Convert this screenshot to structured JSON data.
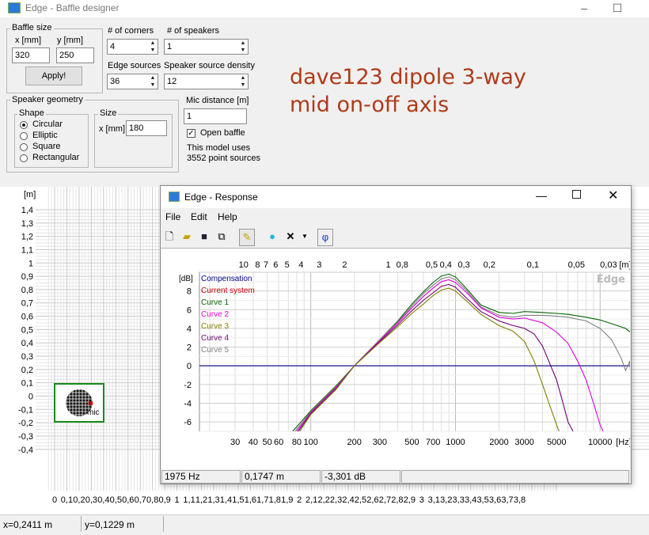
{
  "window": {
    "title": "Edge - Baffle designer",
    "minimize": "–",
    "maximize": "☐"
  },
  "baffle_size": {
    "label": "Baffle size",
    "x_label": "x [mm]",
    "y_label": "y [mm]",
    "x_value": "320",
    "y_value": "250",
    "apply_label": "Apply!"
  },
  "corners": {
    "label": "# of corners",
    "value": "4"
  },
  "speakers": {
    "label": "# of speakers",
    "value": "1"
  },
  "edge_sources": {
    "label": "Edge sources",
    "value": "36"
  },
  "speaker_density": {
    "label": "Speaker source density",
    "value": "12"
  },
  "annotation": {
    "line1": "dave123 dipole 3-way",
    "line2": "mid on-off axis"
  },
  "speaker_geometry": {
    "label": "Speaker geometry",
    "shape_label": "Shape",
    "shapes": [
      "Circular",
      "Elliptic",
      "Square",
      "Rectangular"
    ],
    "selected": "Circular",
    "size_label": "Size",
    "size_x_label": "x [mm]",
    "size_x_value": "180"
  },
  "mic": {
    "distance_label": "Mic distance [m]",
    "distance_value": "1",
    "open_baffle_label": "Open baffle",
    "model_info_1": "This model uses",
    "model_info_2": "3552 point sources",
    "mic_marker": "mic"
  },
  "baffle_plot": {
    "y_unit": "[m]",
    "y_ticks": [
      "1,4",
      "1,3",
      "1,2",
      "1,1",
      "1",
      "0,9",
      "0,8",
      "0,7",
      "0,6",
      "0,5",
      "0,4",
      "0,3",
      "0,2",
      "0,1",
      "0",
      "-0,1",
      "-0,2",
      "-0,3",
      "-0,4"
    ],
    "x_ticks": [
      "0",
      "0,1",
      "0,2",
      "0,3",
      "0,4",
      "0,5",
      "0,6",
      "0,7",
      "0,8",
      "0,9",
      "1",
      "1,1",
      "1,2",
      "1,3",
      "1,4",
      "1,5",
      "1,6",
      "1,7",
      "1,8",
      "1,9",
      "2",
      "2,1",
      "2,2",
      "2,3",
      "2,4",
      "2,5",
      "2,6",
      "2,7",
      "2,8",
      "2,9",
      "3",
      "3,1",
      "3,2",
      "3,3",
      "3,4",
      "3,5",
      "3,6",
      "3,7",
      "3,8"
    ]
  },
  "status": {
    "x": "x=0,2411 m",
    "y": "y=0,1229 m"
  },
  "response": {
    "title": "Edge - Response",
    "menu": [
      "File",
      "Edit",
      "Help"
    ],
    "phi_label": "φ",
    "status": {
      "freq": "1975 Hz",
      "dist": "0,1747 m",
      "level": "-3,301 dB"
    }
  },
  "chart_data": {
    "type": "line",
    "watermark": "Edge",
    "x_scale": "log",
    "xlabel": "[Hz]",
    "ylabel": "[dB]",
    "top_axis_label": "[m]",
    "xlim": [
      17,
      16500
    ],
    "ylim": [
      -7,
      10
    ],
    "x_ticks": [
      30,
      40,
      50,
      60,
      80,
      100,
      200,
      300,
      500,
      700,
      1000,
      2000,
      3000,
      5000,
      10000
    ],
    "x_tick_labels": [
      "30",
      "40",
      "50",
      "60",
      "80",
      "100",
      "200",
      "300",
      "500",
      "700",
      "1000",
      "2000",
      "3000",
      "5000",
      "10000"
    ],
    "y_ticks": [
      8,
      6,
      4,
      2,
      0,
      -2,
      -4,
      -6
    ],
    "y_tick_labels": [
      "8",
      "6",
      "4",
      "2",
      "0",
      "-2",
      "-4",
      "-6"
    ],
    "top_ticks": [
      10,
      8,
      7,
      6,
      5,
      4,
      3,
      2,
      1,
      0.8,
      0.5,
      0.4,
      0.3,
      0.2,
      0.1,
      0.05,
      0.03
    ],
    "top_tick_labels": [
      "10",
      "8",
      "7",
      "6",
      "5",
      "4",
      "3",
      "2",
      "1",
      "0,8",
      "0,5",
      "0,4",
      "0,3",
      "0,2",
      "0,1",
      "0,05",
      "0,03"
    ],
    "legend": [
      "Compensation",
      "Current system",
      "Curve 1",
      "Curve 2",
      "Curve 3",
      "Curve 4",
      "Curve 5"
    ],
    "legend_colors": [
      "#00008b",
      "#c00000",
      "#006400",
      "#e000e0",
      "#808000",
      "#700070",
      "#808080"
    ],
    "series": [
      {
        "name": "Compensation",
        "color": "#00008b",
        "x": [
          17,
          16500
        ],
        "y": [
          0,
          0
        ]
      },
      {
        "name": "Curve 1",
        "color": "#006400",
        "x": [
          75,
          100,
          150,
          200,
          300,
          400,
          500,
          600,
          700,
          800,
          900,
          1000,
          1200,
          1500,
          2000,
          2500,
          3000,
          4000,
          5000,
          6000,
          8000,
          10000,
          12000,
          15000,
          16500
        ],
        "y": [
          -7,
          -4.8,
          -2.1,
          0,
          2.8,
          4.8,
          6.6,
          7.9,
          8.9,
          9.6,
          9.8,
          9.5,
          8.2,
          6.5,
          5.7,
          5.6,
          5.8,
          5.7,
          5.6,
          5.5,
          5.2,
          4.9,
          4.5,
          4.0,
          3.5
        ]
      },
      {
        "name": "Curve 5",
        "color": "#808080",
        "x": [
          78,
          100,
          150,
          200,
          300,
          400,
          500,
          600,
          700,
          800,
          900,
          1000,
          1200,
          1500,
          2000,
          2500,
          3000,
          4000,
          5000,
          6000,
          8000,
          10000,
          12000,
          14000,
          15000,
          16000,
          16500
        ],
        "y": [
          -7,
          -4.9,
          -2.2,
          0,
          2.8,
          4.7,
          6.4,
          7.7,
          8.6,
          9.3,
          9.5,
          9.2,
          8.0,
          6.3,
          5.4,
          5.2,
          5.4,
          5.4,
          5.3,
          5.2,
          4.8,
          4.0,
          2.8,
          0.8,
          -0.5,
          0.5,
          -2.5
        ]
      },
      {
        "name": "Curve 2",
        "color": "#e000e0",
        "x": [
          80,
          100,
          150,
          200,
          300,
          400,
          500,
          600,
          700,
          800,
          900,
          1000,
          1200,
          1500,
          2000,
          2500,
          3000,
          4000,
          5000,
          6000,
          7000,
          8000,
          9000,
          10000,
          10500
        ],
        "y": [
          -7,
          -5.0,
          -2.3,
          0,
          2.7,
          4.6,
          6.2,
          7.4,
          8.3,
          9.0,
          9.2,
          8.9,
          7.8,
          6.2,
          5.2,
          5.0,
          5.1,
          4.6,
          3.6,
          2.4,
          0.5,
          -1.5,
          -4.0,
          -6.3,
          -7
        ]
      },
      {
        "name": "Curve 4",
        "color": "#700070",
        "x": [
          82,
          100,
          150,
          200,
          300,
          400,
          500,
          600,
          700,
          800,
          900,
          1000,
          1200,
          1500,
          2000,
          2500,
          3000,
          3500,
          4000,
          5000,
          5500,
          6000,
          6500
        ],
        "y": [
          -7,
          -5.1,
          -2.4,
          0,
          2.6,
          4.4,
          5.9,
          7.0,
          7.8,
          8.5,
          8.7,
          8.4,
          7.2,
          5.8,
          4.8,
          4.3,
          4.0,
          3.4,
          2.1,
          -1.5,
          -3.8,
          -6.0,
          -7
        ]
      },
      {
        "name": "Curve 3",
        "color": "#808000",
        "x": [
          84,
          100,
          150,
          200,
          300,
          400,
          500,
          600,
          700,
          800,
          900,
          1000,
          1200,
          1500,
          2000,
          2500,
          3000,
          3500,
          4000,
          4500,
          5000,
          5200
        ],
        "y": [
          -7,
          -5.2,
          -2.5,
          0,
          2.5,
          4.2,
          5.6,
          6.6,
          7.5,
          8.1,
          8.3,
          8.0,
          6.9,
          5.5,
          4.3,
          3.7,
          2.6,
          0.5,
          -2.0,
          -4.3,
          -6.3,
          -7
        ]
      }
    ]
  }
}
